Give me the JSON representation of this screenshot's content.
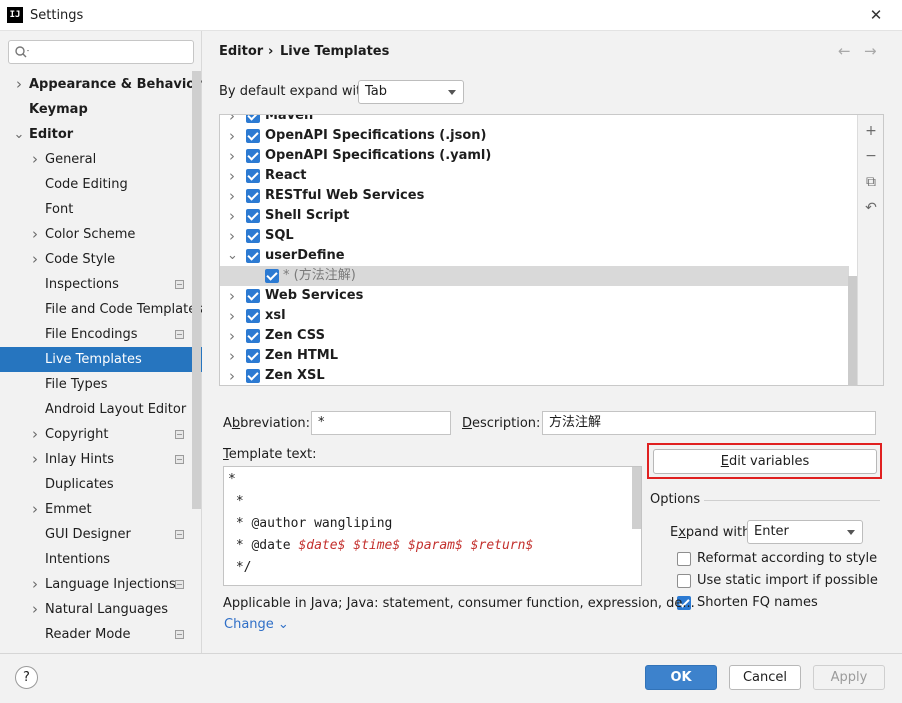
{
  "window": {
    "title": "Settings",
    "app_icon": "IJ"
  },
  "search": {
    "value": ""
  },
  "sidebar": {
    "items": [
      {
        "label": "Appearance & Behavior",
        "level": 0,
        "bold": true,
        "chevron": "right"
      },
      {
        "label": "Keymap",
        "level": 0,
        "bold": true,
        "chevron": ""
      },
      {
        "label": "Editor",
        "level": 0,
        "bold": true,
        "chevron": "down"
      },
      {
        "label": "General",
        "level": 1,
        "chevron": "right"
      },
      {
        "label": "Code Editing",
        "level": 1,
        "chevron": ""
      },
      {
        "label": "Font",
        "level": 1,
        "chevron": ""
      },
      {
        "label": "Color Scheme",
        "level": 1,
        "chevron": "right"
      },
      {
        "label": "Code Style",
        "level": 1,
        "chevron": "right"
      },
      {
        "label": "Inspections",
        "level": 1,
        "chevron": "",
        "cfg": true
      },
      {
        "label": "File and Code Templates",
        "level": 1,
        "chevron": ""
      },
      {
        "label": "File Encodings",
        "level": 1,
        "chevron": "",
        "cfg": true
      },
      {
        "label": "Live Templates",
        "level": 1,
        "chevron": "",
        "selected": true
      },
      {
        "label": "File Types",
        "level": 1,
        "chevron": ""
      },
      {
        "label": "Android Layout Editor",
        "level": 1,
        "chevron": ""
      },
      {
        "label": "Copyright",
        "level": 1,
        "chevron": "right",
        "cfg": true
      },
      {
        "label": "Inlay Hints",
        "level": 1,
        "chevron": "right",
        "cfg": true
      },
      {
        "label": "Duplicates",
        "level": 1,
        "chevron": ""
      },
      {
        "label": "Emmet",
        "level": 1,
        "chevron": "right"
      },
      {
        "label": "GUI Designer",
        "level": 1,
        "chevron": "",
        "cfg": true
      },
      {
        "label": "Intentions",
        "level": 1,
        "chevron": ""
      },
      {
        "label": "Language Injections",
        "level": 1,
        "chevron": "right",
        "cfg": true
      },
      {
        "label": "Natural Languages",
        "level": 1,
        "chevron": "right"
      },
      {
        "label": "Reader Mode",
        "level": 1,
        "chevron": "",
        "cfg": true
      }
    ]
  },
  "header": {
    "crumb_editor": "Editor",
    "crumb_sep": "›",
    "crumb_page": "Live Templates"
  },
  "expand_default": {
    "label": "By default expand with",
    "value": "Tab"
  },
  "templates": {
    "rows": [
      {
        "label": "Maven",
        "type": "group",
        "chevron": "right",
        "checked": true
      },
      {
        "label": "OpenAPI Specifications (.json)",
        "type": "group",
        "chevron": "right",
        "checked": true
      },
      {
        "label": "OpenAPI Specifications (.yaml)",
        "type": "group",
        "chevron": "right",
        "checked": true
      },
      {
        "label": "React",
        "type": "group",
        "chevron": "right",
        "checked": true
      },
      {
        "label": "RESTful Web Services",
        "type": "group",
        "chevron": "right",
        "checked": true
      },
      {
        "label": "Shell Script",
        "type": "group",
        "chevron": "right",
        "checked": true
      },
      {
        "label": "SQL",
        "type": "group",
        "chevron": "right",
        "checked": true
      },
      {
        "label": "userDefine",
        "type": "group",
        "chevron": "down",
        "checked": true
      },
      {
        "label": "* (方法注解)",
        "type": "item",
        "chevron": "",
        "checked": true,
        "selected": true
      },
      {
        "label": "Web Services",
        "type": "group",
        "chevron": "right",
        "checked": true
      },
      {
        "label": "xsl",
        "type": "group",
        "chevron": "right",
        "checked": true
      },
      {
        "label": "Zen CSS",
        "type": "group",
        "chevron": "right",
        "checked": true
      },
      {
        "label": "Zen HTML",
        "type": "group",
        "chevron": "right",
        "checked": true
      },
      {
        "label": "Zen XSL",
        "type": "group",
        "chevron": "right",
        "checked": true
      }
    ]
  },
  "toolbar": {
    "add": "+",
    "remove": "−",
    "copy": "⧉",
    "restore": "↶"
  },
  "abbreviation": {
    "label": "Abbreviation:",
    "value": "*"
  },
  "description": {
    "label": "Description:",
    "value": "方法注解"
  },
  "template_text": {
    "label": "Template text:",
    "lines": [
      "*",
      " *",
      " * @author wangliping"
    ],
    "line4_prefix": " * @date ",
    "line4_vars": [
      "$date$",
      "$time$",
      "$param$",
      "$return$"
    ],
    "line5": " */"
  },
  "edit_variables": {
    "label": "Edit variables"
  },
  "options": {
    "title": "Options",
    "expand_with_label": "Expand with",
    "expand_with_value": "Enter",
    "reformat": {
      "label": "Reformat according to style",
      "checked": false
    },
    "static_import": {
      "label": "Use static import if possible",
      "checked": false
    },
    "shorten_fq": {
      "label": "Shorten FQ names",
      "checked": true
    }
  },
  "applicable": {
    "text": "Applicable in Java; Java: statement, consumer function, expression, de...",
    "change_label": "Change"
  },
  "buttons": {
    "help": "?",
    "ok": "OK",
    "cancel": "Cancel",
    "apply": "Apply"
  }
}
